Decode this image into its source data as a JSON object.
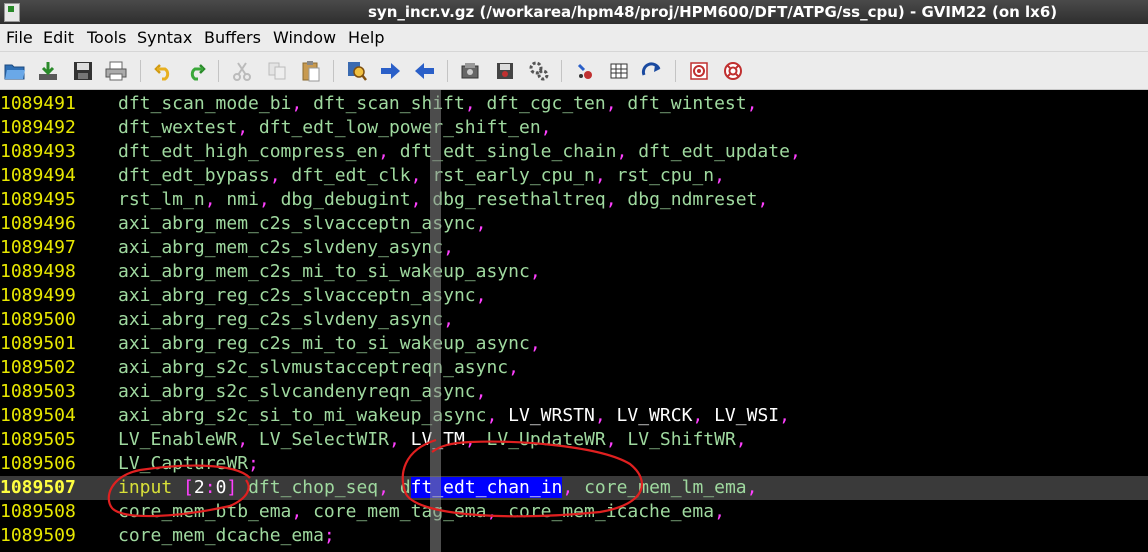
{
  "window": {
    "title": "syn_incr.v.gz (/workarea/hpm48/proj/HPM600/DFT/ATPG/ss_cpu) - GVIM22 (on lx6)"
  },
  "menu": {
    "items": [
      "File",
      "Edit",
      "Tools",
      "Syntax",
      "Buffers",
      "Window",
      "Help"
    ]
  },
  "toolbar": {
    "buttons": [
      "open-icon",
      "save-download-icon",
      "save-icon",
      "print-icon",
      "undo-icon",
      "redo-icon",
      "cut-icon",
      "copy-icon",
      "paste-icon",
      "replace-icon",
      "forward-arrow-icon",
      "back-arrow-icon",
      "load-session-icon",
      "save-session-icon",
      "run-script-icon",
      "make-icon",
      "shell-icon",
      "tag-jump-icon",
      "help-icon",
      "find-help-icon"
    ]
  },
  "colors": {
    "line_number": "#e8e800",
    "identifier": "#9fd99f",
    "punctuation": "#ff40ff",
    "keyword": "#d8e038",
    "selection": "#0000ff",
    "annotation": "#e02020"
  },
  "editor": {
    "lines": [
      {
        "num": "1089491",
        "tokens": [
          [
            "i",
            "dft_scan_mode_bi"
          ],
          [
            "p",
            ", "
          ],
          [
            "i",
            "dft_scan_shift"
          ],
          [
            "p",
            ", "
          ],
          [
            "i",
            "dft_cgc_ten"
          ],
          [
            "p",
            ", "
          ],
          [
            "i",
            "dft_wintest"
          ],
          [
            "p",
            ","
          ]
        ]
      },
      {
        "num": "1089492",
        "tokens": [
          [
            "i",
            "dft_wextest"
          ],
          [
            "p",
            ", "
          ],
          [
            "i",
            "dft_edt_low_power_shift_en"
          ],
          [
            "p",
            ","
          ]
        ]
      },
      {
        "num": "1089493",
        "tokens": [
          [
            "i",
            "dft_edt_high_compress_en"
          ],
          [
            "p",
            ", "
          ],
          [
            "i",
            "dft_edt_single_chain"
          ],
          [
            "p",
            ", "
          ],
          [
            "i",
            "dft_edt_update"
          ],
          [
            "p",
            ","
          ]
        ]
      },
      {
        "num": "1089494",
        "tokens": [
          [
            "i",
            "dft_edt_bypass"
          ],
          [
            "p",
            ", "
          ],
          [
            "i",
            "dft_edt_clk"
          ],
          [
            "p",
            ", "
          ],
          [
            "i",
            "rst_early_cpu_n"
          ],
          [
            "p",
            ", "
          ],
          [
            "i",
            "rst_cpu_n"
          ],
          [
            "p",
            ","
          ]
        ]
      },
      {
        "num": "1089495",
        "tokens": [
          [
            "i",
            "rst_lm_n"
          ],
          [
            "p",
            ", "
          ],
          [
            "i",
            "nmi"
          ],
          [
            "p",
            ", "
          ],
          [
            "i",
            "dbg_debugint"
          ],
          [
            "p",
            ", "
          ],
          [
            "i",
            "dbg_resethaltreq"
          ],
          [
            "p",
            ", "
          ],
          [
            "i",
            "dbg_ndmreset"
          ],
          [
            "p",
            ","
          ]
        ]
      },
      {
        "num": "1089496",
        "tokens": [
          [
            "i",
            "axi_abrg_mem_c2s_slvacceptn_async"
          ],
          [
            "p",
            ","
          ]
        ]
      },
      {
        "num": "1089497",
        "tokens": [
          [
            "i",
            "axi_abrg_mem_c2s_slvdeny_async"
          ],
          [
            "p",
            ","
          ]
        ]
      },
      {
        "num": "1089498",
        "tokens": [
          [
            "i",
            "axi_abrg_mem_c2s_mi_to_si_wakeup_async"
          ],
          [
            "p",
            ","
          ]
        ]
      },
      {
        "num": "1089499",
        "tokens": [
          [
            "i",
            "axi_abrg_reg_c2s_slvacceptn_async"
          ],
          [
            "p",
            ","
          ]
        ]
      },
      {
        "num": "1089500",
        "tokens": [
          [
            "i",
            "axi_abrg_reg_c2s_slvdeny_async"
          ],
          [
            "p",
            ","
          ]
        ]
      },
      {
        "num": "1089501",
        "tokens": [
          [
            "i",
            "axi_abrg_reg_c2s_mi_to_si_wakeup_async"
          ],
          [
            "p",
            ","
          ]
        ]
      },
      {
        "num": "1089502",
        "tokens": [
          [
            "i",
            "axi_abrg_s2c_slvmustacceptreqn_async"
          ],
          [
            "p",
            ","
          ]
        ]
      },
      {
        "num": "1089503",
        "tokens": [
          [
            "i",
            "axi_abrg_s2c_slvcandenyreqn_async"
          ],
          [
            "p",
            ","
          ]
        ]
      },
      {
        "num": "1089504",
        "tokens": [
          [
            "i",
            "axi_abrg_s2c_si_to_mi_wakeup_async"
          ],
          [
            "p",
            ", "
          ],
          [
            "w",
            "LV_WRSTN"
          ],
          [
            "p",
            ", "
          ],
          [
            "w",
            "LV_WRCK"
          ],
          [
            "p",
            ", "
          ],
          [
            "w",
            "LV_WSI"
          ],
          [
            "p",
            ","
          ]
        ]
      },
      {
        "num": "1089505",
        "tokens": [
          [
            "i",
            "LV_EnableWR"
          ],
          [
            "p",
            ", "
          ],
          [
            "i",
            "LV_SelectWIR"
          ],
          [
            "p",
            ", "
          ],
          [
            "w",
            "LV_TM"
          ],
          [
            "p",
            ", "
          ],
          [
            "i",
            "LV_UpdateWR"
          ],
          [
            "p",
            ", "
          ],
          [
            "i",
            "LV_ShiftWR"
          ],
          [
            "p",
            ","
          ]
        ]
      },
      {
        "num": "1089506",
        "tokens": [
          [
            "i",
            "LV_CaptureWR"
          ],
          [
            "p",
            ";"
          ]
        ]
      },
      {
        "num": "1089507",
        "current": true,
        "tokens": [
          [
            "k",
            "input"
          ],
          [
            "p",
            " "
          ],
          [
            "p",
            "["
          ],
          [
            "n",
            "2"
          ],
          [
            "p",
            ":"
          ],
          [
            "n",
            "0"
          ],
          [
            "p",
            "] "
          ],
          [
            "i",
            "dft_chop_seq"
          ],
          [
            "p",
            ", "
          ],
          [
            "i",
            "d"
          ],
          [
            "s",
            "ft_edt_chan_in"
          ],
          [
            "p",
            ", "
          ],
          [
            "i",
            "core_mem_lm_ema"
          ],
          [
            "p",
            ","
          ]
        ]
      },
      {
        "num": "1089508",
        "tokens": [
          [
            "i",
            "core_mem_btb_ema"
          ],
          [
            "p",
            ", "
          ],
          [
            "i",
            "core_mem_tag_ema"
          ],
          [
            "p",
            ", "
          ],
          [
            "i",
            "core_mem_icache_ema"
          ],
          [
            "p",
            ","
          ]
        ]
      },
      {
        "num": "1089509",
        "tokens": [
          [
            "i",
            "core_mem_dcache_ema"
          ],
          [
            "p",
            ";"
          ]
        ]
      }
    ]
  }
}
